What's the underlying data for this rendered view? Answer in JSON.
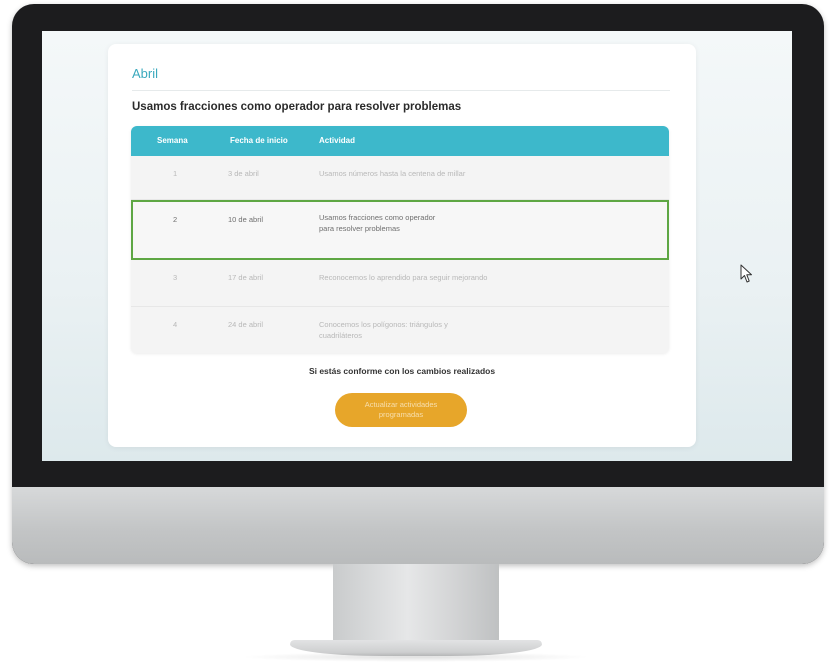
{
  "page": {
    "month": "Abril",
    "section_title": "Usamos fracciones como operador para resolver problemas"
  },
  "table": {
    "headers": {
      "week": "Semana",
      "start_date": "Fecha de inicio",
      "activity": "Actividad"
    },
    "rows": [
      {
        "week": "1",
        "start_date": "3 de abril",
        "activity": "Usamos números hasta la centena de millar"
      },
      {
        "week": "2",
        "start_date": "10 de abril",
        "activity": "Usamos fracciones como operador para resolver problemas"
      },
      {
        "week": "3",
        "start_date": "17 de abril",
        "activity": "Reconocemos lo aprendido para seguir mejorando"
      },
      {
        "week": "4",
        "start_date": "24 de abril",
        "activity": "Conocemos los polígonos: triángulos y cuadriláteros"
      }
    ],
    "highlighted_row": 2
  },
  "footer": {
    "confirm_text": "Si estás conforme con los cambios realizados",
    "button_label": "Actualizar actividades programadas"
  },
  "colors": {
    "header_bg": "#3db8cb",
    "highlight_border": "#5ea744",
    "button_bg": "#e7a62a",
    "month_title": "#3aa9bd"
  },
  "icons": {
    "cursor": "mouse-pointer-icon"
  }
}
